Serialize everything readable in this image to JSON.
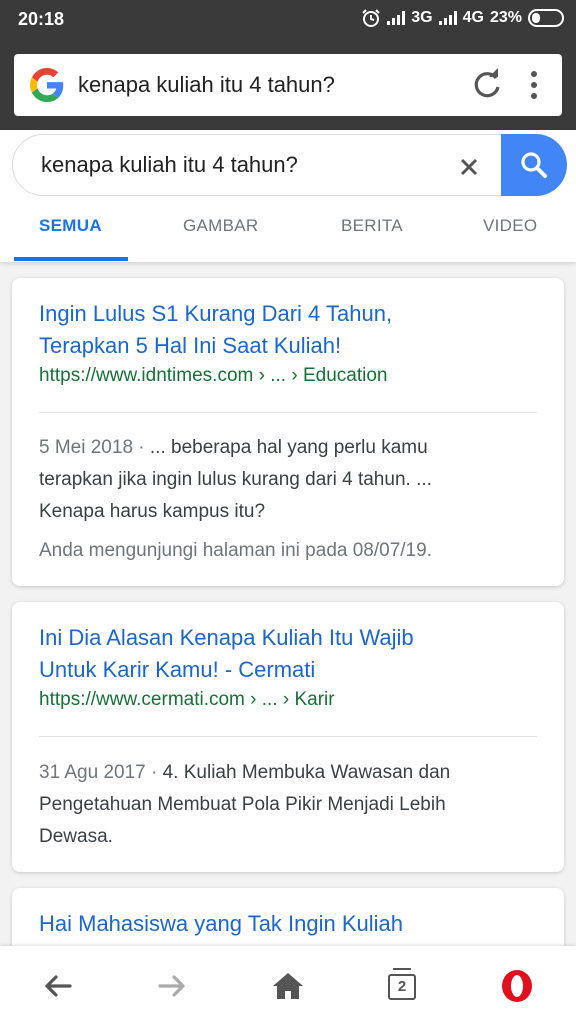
{
  "status_bar": {
    "time": "20:18",
    "network_1": "3G",
    "network_2": "4G",
    "battery": "23%"
  },
  "browser": {
    "address_text": "kenapa kuliah itu 4 tahun?",
    "tab_count": "2"
  },
  "search": {
    "query": "kenapa kuliah itu 4 tahun?"
  },
  "tabs": [
    {
      "label": "SEMUA",
      "active": true
    },
    {
      "label": "GAMBAR",
      "active": false
    },
    {
      "label": "BERITA",
      "active": false
    },
    {
      "label": "VIDEO",
      "active": false
    }
  ],
  "results": [
    {
      "title_line1": "Ingin Lulus S1 Kurang Dari 4 Tahun,",
      "title_line2": "Terapkan 5 Hal Ini Saat Kuliah!",
      "url": "https://www.idntimes.com › ... › Education",
      "date": "5 Mei 2018 · ",
      "snippet_line1": "... beberapa hal yang perlu kamu",
      "snippet_line2": "terapkan jika ingin lulus kurang dari 4 tahun. ...",
      "snippet_line3": "Kenapa harus kampus itu?",
      "visited": "Anda mengunjungi halaman ini pada 08/07/19."
    },
    {
      "title_line1": "Ini Dia Alasan Kenapa Kuliah Itu Wajib",
      "title_line2": "Untuk Karir Kamu! - Cermati",
      "url": "https://www.cermati.com › ... › Karir",
      "date": "31 Agu 2017 · ",
      "snippet_line1": "4. Kuliah Membuka Wawasan dan",
      "snippet_line2": "Pengetahuan Membuat Pola Pikir Menjadi Lebih",
      "snippet_line3": "Dewasa."
    },
    {
      "title_line1": "Hai Mahasiswa yang Tak Ingin Kuliah"
    }
  ],
  "colors": {
    "link": "#1967d2",
    "url": "#137333",
    "accent": "#4285f4",
    "opera": "#e0101f"
  }
}
